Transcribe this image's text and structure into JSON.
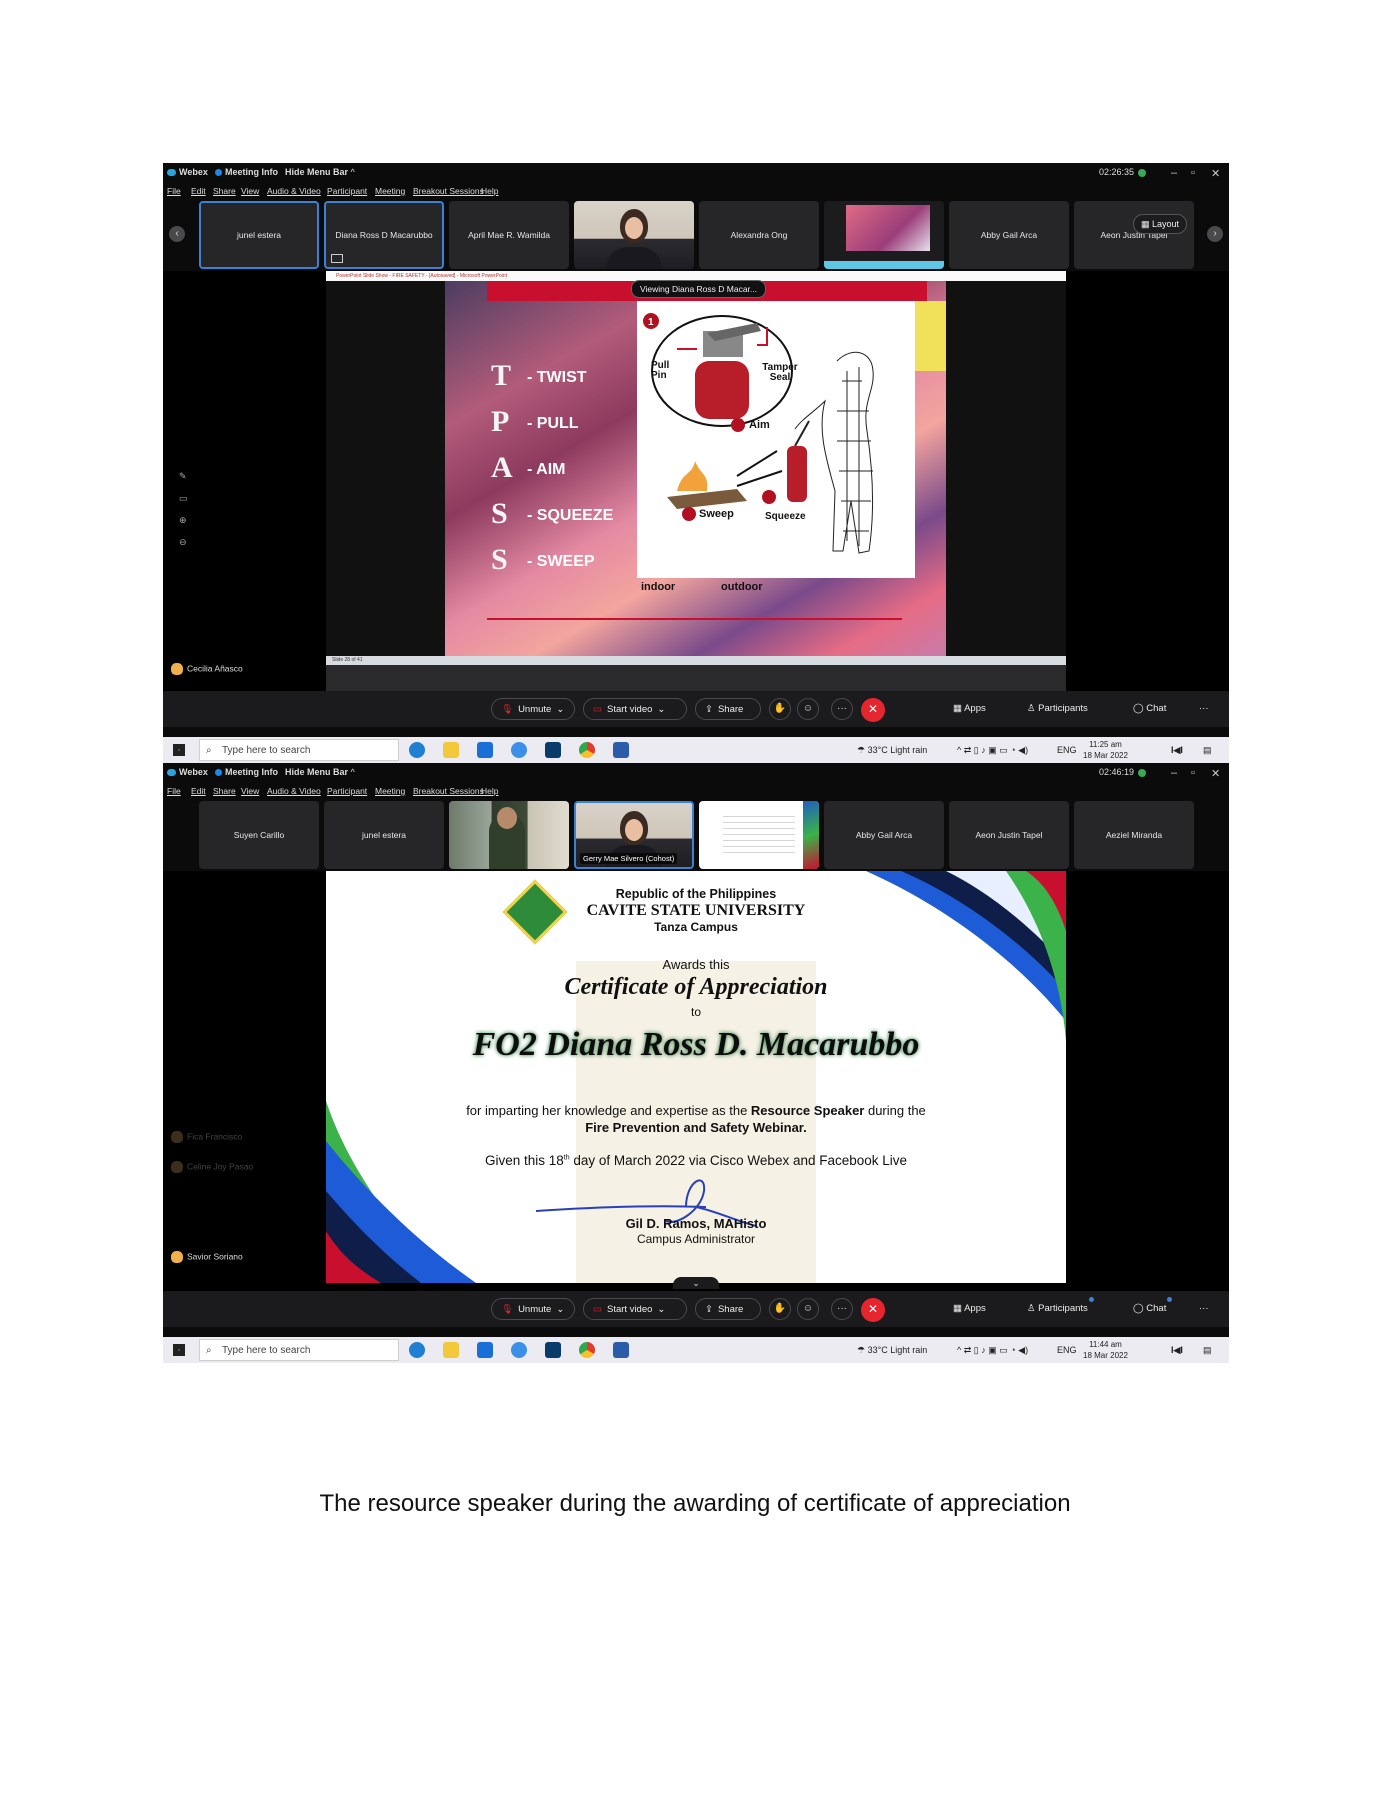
{
  "top": {
    "titlebar": {
      "app": "Webex",
      "meeting_info": "Meeting Info",
      "hide_menu": "Hide Menu Bar",
      "timer": "02:26:35"
    },
    "menu": [
      "File",
      "Edit",
      "Share",
      "View",
      "Audio & Video",
      "Participant",
      "Meeting",
      "Breakout Sessions",
      "Help"
    ],
    "participants": [
      "junel estera",
      "Diana Ross D Macarubbo",
      "April Mae R. Wamilda",
      "",
      "Alexandra Ong",
      "",
      "Abby Gail Arca",
      "Aeon Justin Tapel"
    ],
    "layout_label": "Layout",
    "viewing_label": "Viewing Diana Ross D Macar...",
    "ppt_title": "PowerPoint Slide Show - FIRE SAFETY - [Autosaved] - Microsoft PowerPoint",
    "ppt_status": "Slide 28 of 41",
    "slide": {
      "letters": [
        "T",
        "P",
        "A",
        "S",
        "S"
      ],
      "words": [
        "- TWIST",
        "- PULL",
        "- AIM",
        "- SQUEEZE",
        "- SWEEP"
      ],
      "diagram_labels": {
        "pull_pin": "Pull Pin",
        "tamper_seal": "Tamper Seal",
        "aim": "Aim",
        "squeeze": "Squeeze",
        "sweep": "Sweep"
      },
      "indoor": "indoor",
      "outdoor": "outdoor"
    },
    "side_name": "Cecilia Añasco",
    "clock": {
      "time": "11:25 am",
      "date": "18 Mar 2022"
    }
  },
  "bottom": {
    "titlebar": {
      "app": "Webex",
      "meeting_info": "Meeting Info",
      "hide_menu": "Hide Menu Bar",
      "timer": "02:46:19"
    },
    "menu": [
      "File",
      "Edit",
      "Share",
      "View",
      "Audio & Video",
      "Participant",
      "Meeting",
      "Breakout Sessions",
      "Help"
    ],
    "participants": [
      "Suyen Carillo",
      "junel estera",
      "",
      "",
      "",
      "Abby Gail Arca",
      "Aeon Justin Tapel",
      "Aeziel Miranda"
    ],
    "cohost_caption": "Gerry Mae Silvero (Cohost)",
    "certificate": {
      "line1": "Republic of the Philippines",
      "line2": "CAVITE STATE UNIVERSITY",
      "line3": "Tanza Campus",
      "awards": "Awards this",
      "title": "Certificate of Appreciation",
      "to": "to",
      "name": "FO2 Diana Ross D. Macarubbo",
      "body1_pre": "for imparting her knowledge and expertise as the ",
      "body1_bold": "Resource Speaker",
      "body1_post": " during the",
      "body2": "Fire Prevention and Safety Webinar.",
      "given_pre": "Given this 18",
      "given_sup": "th",
      "given_post": " day of March 2022 via Cisco Webex and Facebook Live",
      "signatory": "Gil D. Ramos, MAHisto",
      "signatory_title": "Campus Administrator"
    },
    "side_names": [
      "Fica Francisco",
      "Celine Joy Pasao",
      "Savior Soriano"
    ],
    "clock": {
      "time": "11:44 am",
      "date": "18 Mar 2022"
    }
  },
  "toolbar": {
    "unmute": "Unmute",
    "start_video": "Start video",
    "share": "Share",
    "apps": "Apps",
    "participants": "Participants",
    "chat": "Chat",
    "more": "···"
  },
  "taskbar": {
    "search_placeholder": "Type here to search",
    "weather": "33°C  Light rain",
    "lang": "ENG"
  },
  "caption": "The resource speaker during the awarding of certificate of appreciation",
  "colors": {
    "end_call": "#e5262f",
    "accent": "#3b82d6",
    "slide_red": "#c8102e",
    "certificate_green": "#0f6b2a"
  }
}
